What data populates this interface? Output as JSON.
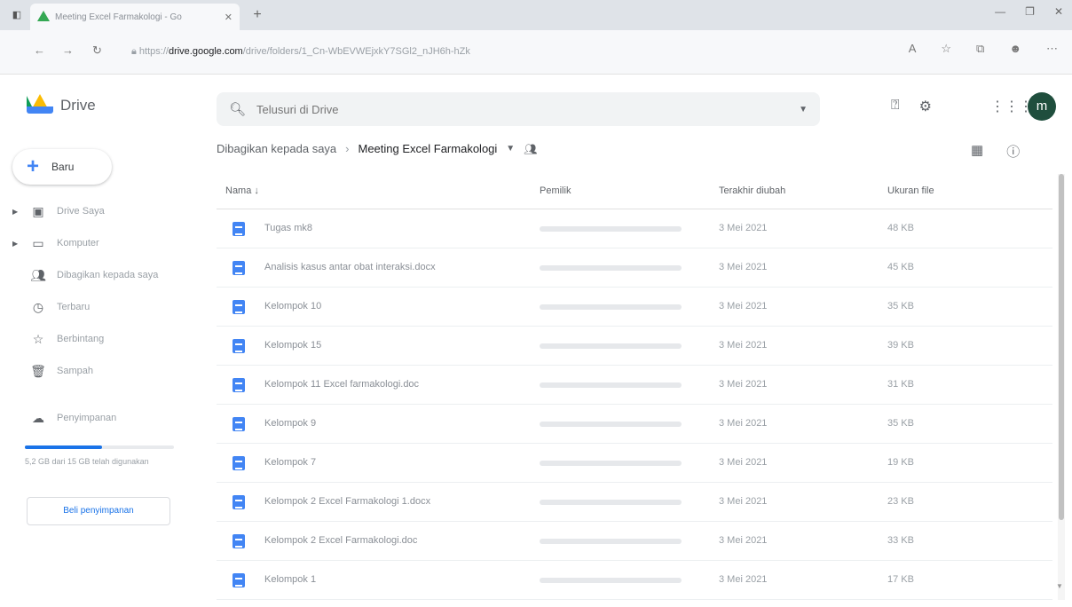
{
  "browser": {
    "tab_title": "Meeting Excel Farmakologi - Go",
    "url_prefix": "https://",
    "url_host": "drive.google.com",
    "url_path": "/drive/folders/1_Cn-WbEVWEjxkY7SGl2_nJH6h-hZk"
  },
  "header": {
    "logo_text": "Drive",
    "search_placeholder": "Telusuri di Drive",
    "avatar_letter": "m"
  },
  "sidebar": {
    "new_label": "Baru",
    "items": [
      {
        "label": "Drive Saya",
        "icon": "my-drive-icon"
      },
      {
        "label": "Komputer",
        "icon": "computer-icon"
      },
      {
        "label": "Dibagikan kepada saya",
        "icon": "shared-icon"
      },
      {
        "label": "Terbaru",
        "icon": "clock-icon"
      },
      {
        "label": "Berbintang",
        "icon": "star-icon"
      },
      {
        "label": "Sampah",
        "icon": "trash-icon"
      }
    ],
    "storage_label": "Penyimpanan",
    "storage_used_fraction": 0.52,
    "storage_text": "5,2 GB dari 15 GB telah digunakan",
    "buy_storage": "Beli penyimpanan"
  },
  "main": {
    "breadcrumb_root": "Dibagikan kepada saya",
    "breadcrumb_current": "Meeting Excel Farmakologi",
    "columns": {
      "name": "Nama",
      "owner": "Pemilik",
      "modified": "Terakhir diubah",
      "size": "Ukuran file"
    },
    "files": [
      {
        "name": "Tugas mk8",
        "modified": "3 Mei 2021",
        "size": "48 KB"
      },
      {
        "name": "Analisis kasus antar obat interaksi.docx",
        "modified": "3 Mei 2021",
        "size": "45 KB"
      },
      {
        "name": "Kelompok 10",
        "modified": "3 Mei 2021",
        "size": "35 KB"
      },
      {
        "name": "Kelompok 15",
        "modified": "3 Mei 2021",
        "size": "39 KB"
      },
      {
        "name": "Kelompok 11 Excel farmakologi.doc",
        "modified": "3 Mei 2021",
        "size": "31 KB"
      },
      {
        "name": "Kelompok 9",
        "modified": "3 Mei 2021",
        "size": "35 KB"
      },
      {
        "name": "Kelompok 7",
        "modified": "3 Mei 2021",
        "size": "19 KB"
      },
      {
        "name": "Kelompok 2 Excel Farmakologi 1.docx",
        "modified": "3 Mei 2021",
        "size": "23 KB"
      },
      {
        "name": "Kelompok 2 Excel Farmakologi.doc",
        "modified": "3 Mei 2021",
        "size": "33 KB"
      },
      {
        "name": "Kelompok 1",
        "modified": "3 Mei 2021",
        "size": "17 KB"
      }
    ]
  }
}
